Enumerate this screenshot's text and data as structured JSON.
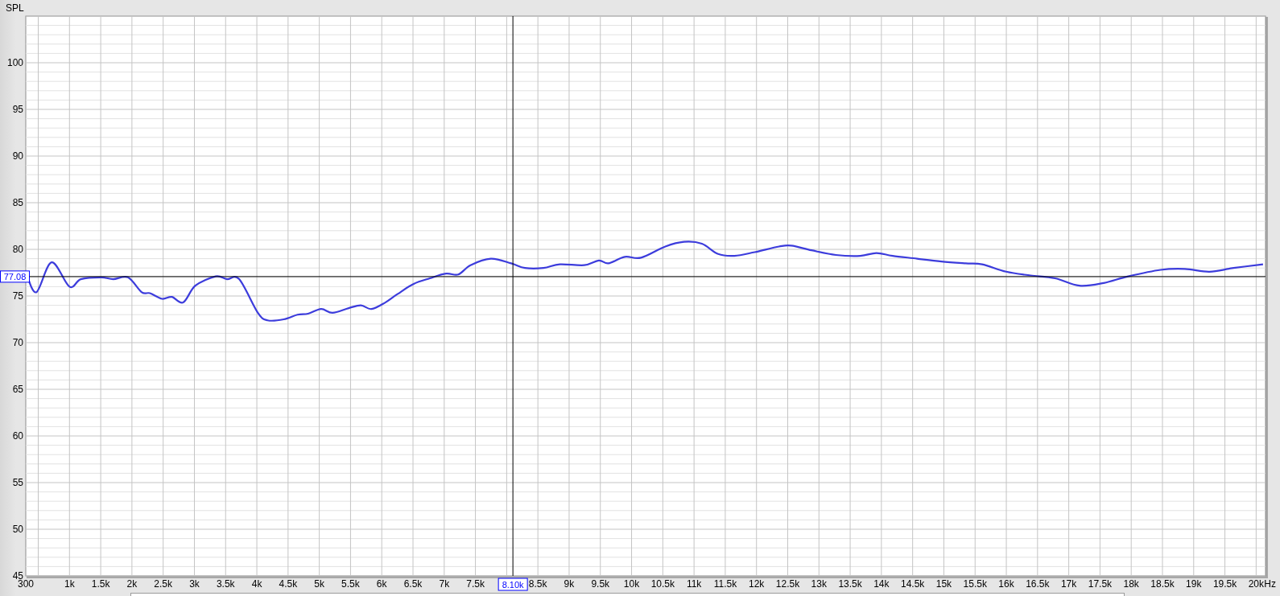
{
  "chart_data": {
    "type": "line",
    "ylabel": "SPL",
    "xlabel": "Hz",
    "grid": true,
    "xlim": [
      300,
      20150
    ],
    "ylim": [
      45,
      105
    ],
    "yticks": [
      45,
      50,
      55,
      60,
      65,
      70,
      75,
      80,
      85,
      90,
      95,
      100
    ],
    "xticks": [
      {
        "value": 300,
        "label": "300"
      },
      {
        "value": 1000,
        "label": "1k"
      },
      {
        "value": 1500,
        "label": "1.5k"
      },
      {
        "value": 2000,
        "label": "2k"
      },
      {
        "value": 2500,
        "label": "2.5k"
      },
      {
        "value": 3000,
        "label": "3k"
      },
      {
        "value": 3500,
        "label": "3.5k"
      },
      {
        "value": 4000,
        "label": "4k"
      },
      {
        "value": 4500,
        "label": "4.5k"
      },
      {
        "value": 5000,
        "label": "5k"
      },
      {
        "value": 5500,
        "label": "5.5k"
      },
      {
        "value": 6000,
        "label": "6k"
      },
      {
        "value": 6500,
        "label": "6.5k"
      },
      {
        "value": 7000,
        "label": "7k"
      },
      {
        "value": 7500,
        "label": "7.5k"
      },
      {
        "value": 8500,
        "label": "8.5k"
      },
      {
        "value": 9000,
        "label": "9k"
      },
      {
        "value": 9500,
        "label": "9.5k"
      },
      {
        "value": 10000,
        "label": "10k"
      },
      {
        "value": 10500,
        "label": "10.5k"
      },
      {
        "value": 11000,
        "label": "11k"
      },
      {
        "value": 11500,
        "label": "11.5k"
      },
      {
        "value": 12000,
        "label": "12k"
      },
      {
        "value": 12500,
        "label": "12.5k"
      },
      {
        "value": 13000,
        "label": "13k"
      },
      {
        "value": 13500,
        "label": "13.5k"
      },
      {
        "value": 14000,
        "label": "14k"
      },
      {
        "value": 14500,
        "label": "14.5k"
      },
      {
        "value": 15000,
        "label": "15k"
      },
      {
        "value": 15500,
        "label": "15.5k"
      },
      {
        "value": 16000,
        "label": "16k"
      },
      {
        "value": 16500,
        "label": "16.5k"
      },
      {
        "value": 17000,
        "label": "17k"
      },
      {
        "value": 17500,
        "label": "17.5k"
      },
      {
        "value": 18000,
        "label": "18k"
      },
      {
        "value": 18500,
        "label": "18.5k"
      },
      {
        "value": 19000,
        "label": "19k"
      },
      {
        "value": 19500,
        "label": "19.5k"
      },
      {
        "value": 20000,
        "label": "20k"
      }
    ],
    "x": [
      300,
      467,
      714,
      1000,
      1182,
      1507,
      1700,
      1936,
      2157,
      2287,
      2482,
      2638,
      2820,
      3015,
      3340,
      3522,
      3717,
      4016,
      4171,
      4431,
      4652,
      4821,
      5029,
      5211,
      5471,
      5666,
      5835,
      6056,
      6251,
      6511,
      6771,
      7031,
      7226,
      7421,
      7746,
      8071,
      8292,
      8591,
      8851,
      9241,
      9475,
      9631,
      9891,
      10151,
      10541,
      10840,
      11126,
      11386,
      11646,
      11971,
      12361,
      12556,
      12881,
      13271,
      13661,
      13921,
      14181,
      14571,
      14961,
      15351,
      15611,
      15997,
      16390,
      16780,
      17171,
      17561,
      17951,
      18470,
      18860,
      19250,
      19640,
      20110
    ],
    "series": [
      {
        "color": "#3c3cdc",
        "values": [
          77.6,
          75.4,
          78.6,
          76.0,
          76.8,
          77.0,
          76.8,
          77.0,
          75.4,
          75.3,
          74.7,
          74.9,
          74.3,
          76.1,
          77.1,
          76.8,
          76.8,
          73.2,
          72.4,
          72.5,
          73.0,
          73.1,
          73.6,
          73.2,
          73.7,
          74.0,
          73.6,
          74.3,
          75.2,
          76.3,
          76.9,
          77.4,
          77.3,
          78.3,
          79.0,
          78.5,
          78.0,
          78.0,
          78.4,
          78.3,
          78.8,
          78.5,
          79.2,
          79.1,
          80.3,
          80.8,
          80.6,
          79.5,
          79.3,
          79.7,
          80.3,
          80.4,
          79.9,
          79.4,
          79.3,
          79.6,
          79.3,
          79.0,
          78.7,
          78.5,
          78.4,
          77.6,
          77.2,
          76.9,
          76.1,
          76.4,
          77.1,
          77.8,
          77.9,
          77.6,
          78.0,
          78.4
        ]
      }
    ],
    "ref_lines": [
      {
        "axis": "x",
        "value": 8100,
        "label": "8.10k",
        "color": "#000000"
      },
      {
        "axis": "y",
        "value": 77.08,
        "label": "77.08",
        "color": "#000000"
      }
    ]
  }
}
